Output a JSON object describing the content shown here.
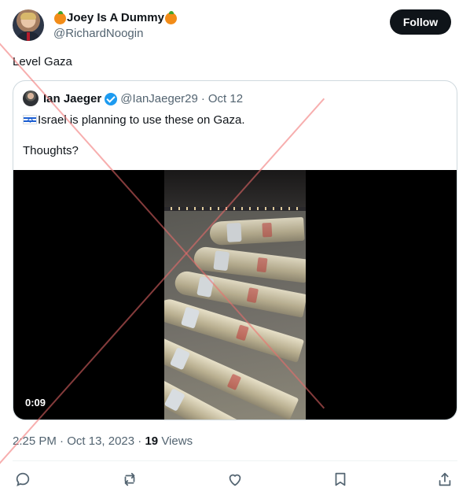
{
  "post": {
    "author": {
      "emoji_left": "orange-emoji",
      "display_name": "Joey Is A Dummy",
      "emoji_right": "orange-emoji",
      "handle": "@RichardNoogin"
    },
    "follow_label": "Follow",
    "text": "Level Gaza",
    "quoted": {
      "author_name": "Ian Jaeger",
      "handle": "@IanJaeger29",
      "separator": "·",
      "date": "Oct 12",
      "flag": "israel-flag",
      "line1": "Israel is planning to use these on Gaza.",
      "line2": "Thoughts?",
      "video_time": "0:09"
    },
    "meta": {
      "time": "2:25 PM",
      "separator": "·",
      "date": "Oct 13, 2023",
      "separator2": "·",
      "views_count": "19",
      "views_label": "Views"
    },
    "actions": {
      "reply_icon": "reply-icon",
      "repost_icon": "repost-icon",
      "like_icon": "like-icon",
      "bookmark_icon": "bookmark-icon",
      "share_icon": "share-icon"
    }
  },
  "colors": {
    "text_primary": "#0f1419",
    "text_secondary": "#536471",
    "border": "#cfd9de",
    "verified": "#1d9bf0",
    "follow_bg": "#0f1419",
    "overlay_x": "#f06c6c"
  }
}
